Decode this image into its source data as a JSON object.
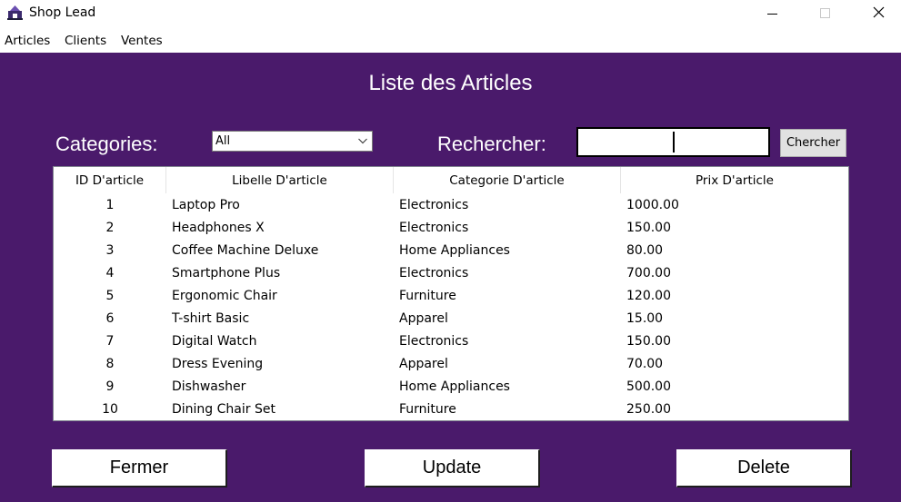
{
  "window": {
    "title": "Shop Lead"
  },
  "menu": {
    "items": [
      "Articles",
      "Clients",
      "Ventes"
    ]
  },
  "page": {
    "title": "Liste des Articles"
  },
  "filters": {
    "category_label": "Categories:",
    "category_value": "All",
    "search_label": "Rechercher:",
    "search_value": "",
    "search_button": "Chercher"
  },
  "table": {
    "headers": [
      "ID D'article",
      "Libelle D'article",
      "Categorie D'article",
      "Prix D'article"
    ],
    "rows": [
      [
        "1",
        "Laptop Pro",
        "Electronics",
        "1000.00"
      ],
      [
        "2",
        "Headphones X",
        "Electronics",
        "150.00"
      ],
      [
        "3",
        "Coffee Machine Deluxe",
        "Home Appliances",
        "80.00"
      ],
      [
        "4",
        "Smartphone Plus",
        "Electronics",
        "700.00"
      ],
      [
        "5",
        "Ergonomic Chair",
        "Furniture",
        "120.00"
      ],
      [
        "6",
        "T-shirt Basic",
        "Apparel",
        "15.00"
      ],
      [
        "7",
        "Digital Watch",
        "Electronics",
        "150.00"
      ],
      [
        "8",
        "Dress Evening",
        "Apparel",
        "70.00"
      ],
      [
        "9",
        "Dishwasher",
        "Home Appliances",
        "500.00"
      ],
      [
        "10",
        "Dining Chair Set",
        "Furniture",
        "250.00"
      ]
    ]
  },
  "actions": {
    "close_label": "Fermer",
    "update_label": "Update",
    "delete_label": "Delete"
  },
  "icons": {
    "app": "app-logo-icon",
    "minimize": "minimize-icon",
    "maximize": "maximize-icon",
    "close": "close-icon",
    "dropdown": "chevron-down-icon"
  },
  "colors": {
    "background": "#4a1a6b",
    "text_light": "#ffffff"
  }
}
